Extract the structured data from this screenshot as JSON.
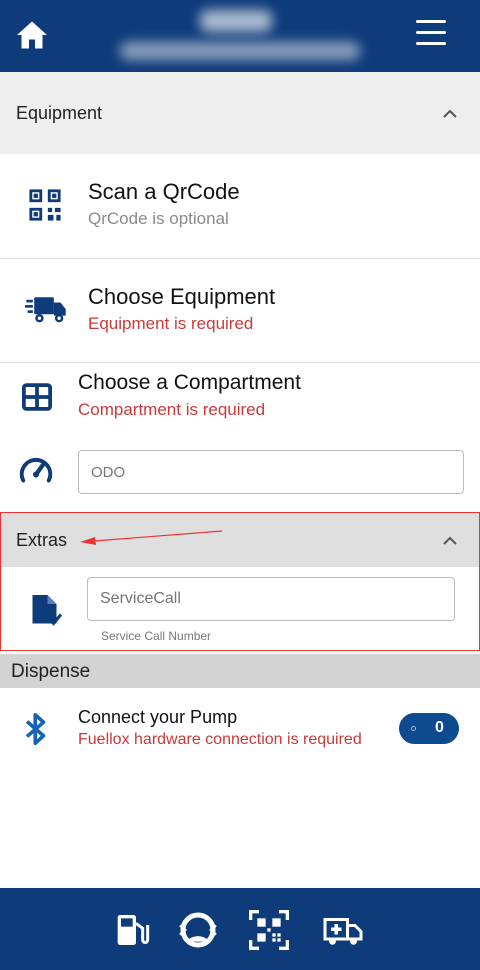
{
  "header": {
    "home_icon": "home-icon",
    "menu_icon": "hamburger-icon"
  },
  "equipment": {
    "label": "Equipment",
    "scan": {
      "title": "Scan a QrCode",
      "subtitle": "QrCode is optional",
      "icon": "qrcode-icon"
    },
    "choose": {
      "title": "Choose Equipment",
      "subtitle": "Equipment is required",
      "icon": "truck-icon"
    },
    "compartment": {
      "title": "Choose a Compartment",
      "subtitle": "Compartment is required",
      "icon": "grid-icon"
    },
    "odo": {
      "placeholder": "ODO",
      "icon": "speedometer-icon"
    }
  },
  "extras": {
    "label": "Extras",
    "service_call": {
      "placeholder": "ServiceCall",
      "helper": "Service Call Number",
      "icon": "document-check-icon"
    }
  },
  "dispense": {
    "label": "Dispense",
    "pump": {
      "title": "Connect your Pump",
      "subtitle": "Fuellox hardware connection is required",
      "icon": "bluetooth-icon",
      "count": "0"
    }
  },
  "bottom_nav": [
    "fuel-pump-icon",
    "refresh-gauge-icon",
    "qrcode-icon",
    "ambulance-icon"
  ],
  "colors": {
    "primary": "#0e3b7a",
    "error": "#c83a3a",
    "section_bg": "#eeeeee"
  }
}
